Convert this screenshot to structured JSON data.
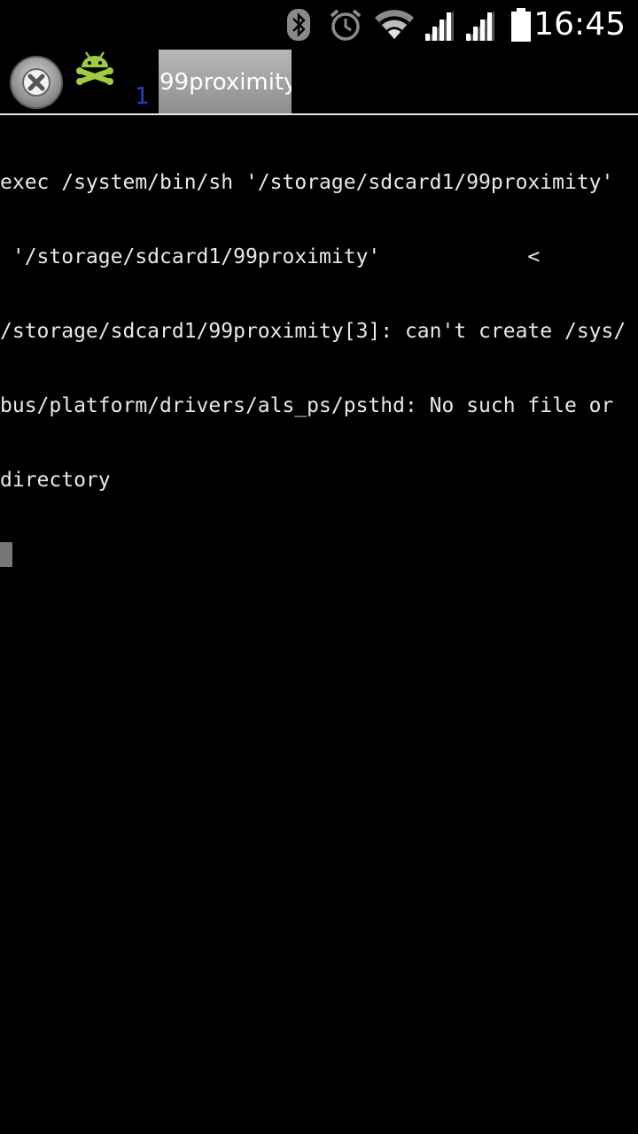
{
  "status_bar": {
    "time": "16:45",
    "icons": [
      "bluetooth-icon",
      "alarm-icon",
      "wifi-icon",
      "signal-icon",
      "signal-icon",
      "battery-icon"
    ]
  },
  "tab_bar": {
    "close_icon": "close-icon",
    "app_icon": "android-terminal-icon",
    "window_count": "1",
    "tabs": [
      {
        "label": "99proximity"
      }
    ]
  },
  "terminal": {
    "lines": [
      "exec /system/bin/sh '/storage/sdcard1/99proximity'",
      " '/storage/sdcard1/99proximity'            <",
      "/storage/sdcard1/99proximity[3]: can't create /sys/",
      "bus/platform/drivers/als_ps/psthd: No such file or",
      "directory"
    ]
  },
  "colors": {
    "background": "#000000",
    "tab_active": "#a3a3a3",
    "window_count": "#2a3ccc",
    "terminal_text": "#e8e8e8",
    "cursor": "#777777"
  }
}
